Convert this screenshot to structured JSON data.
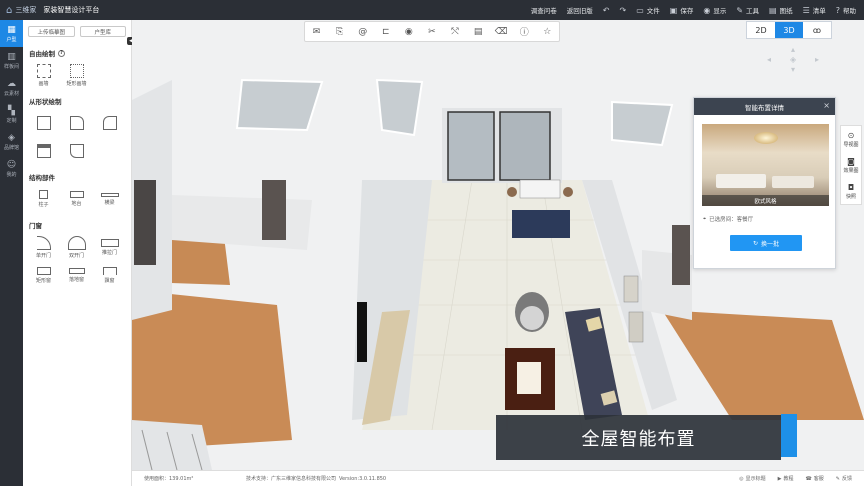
{
  "topbar": {
    "logo_text": "三维家",
    "app_title": "家装智慧设计平台",
    "menu": [
      {
        "label": "调查问卷",
        "icon": ""
      },
      {
        "label": "返回旧版",
        "icon": ""
      },
      {
        "label": "",
        "icon": "undo-icon"
      },
      {
        "label": "",
        "icon": "redo-icon"
      },
      {
        "label": "文件",
        "icon": "folder-icon"
      },
      {
        "label": "保存",
        "icon": "save-icon"
      },
      {
        "label": "显示",
        "icon": "eye-icon"
      },
      {
        "label": "工具",
        "icon": "wrench-icon"
      },
      {
        "label": "图纸",
        "icon": "drawing-icon"
      },
      {
        "label": "清单",
        "icon": "list-icon"
      },
      {
        "label": "帮助",
        "icon": "help-icon"
      }
    ]
  },
  "rail": [
    {
      "label": "户型",
      "icon": "floorplan-icon"
    },
    {
      "label": "样板间",
      "icon": "sample-room-icon"
    },
    {
      "label": "云素材",
      "icon": "cloud-icon"
    },
    {
      "label": "定制",
      "icon": "custom-icon"
    },
    {
      "label": "品牌馆",
      "icon": "tag-icon"
    },
    {
      "label": "我的",
      "icon": "user-icon"
    }
  ],
  "panel": {
    "tabs": [
      "上传临摹图",
      "户型库"
    ],
    "sections": [
      {
        "title": "自由绘制",
        "has_help": true,
        "items": [
          "画墙",
          "矩形画墙"
        ]
      },
      {
        "title": "从形状绘制",
        "has_help": false,
        "items": [
          "",
          "",
          "",
          "",
          ""
        ]
      },
      {
        "title": "结构部件",
        "has_help": false,
        "items": [
          "柱子",
          "地台",
          "横梁"
        ]
      },
      {
        "title": "门窗",
        "has_help": false,
        "items": [
          "单开门",
          "双开门",
          "推拉门",
          "矩形窗",
          "落地窗",
          "飘窗"
        ]
      }
    ]
  },
  "toolbar": {
    "icons": [
      "mail-icon",
      "copy-icon",
      "at-icon",
      "align-icon",
      "eye-icon",
      "scissors-icon",
      "split-icon",
      "layer-icon",
      "eraser-icon",
      "info-icon",
      "star-icon"
    ]
  },
  "view_switch": {
    "options": [
      "2D",
      "3D",
      "漫游"
    ],
    "active": "3D"
  },
  "right_tools": [
    "导视图",
    "效果图",
    "快照"
  ],
  "popup": {
    "title": "智能布置详情",
    "image_caption": "欧式风格",
    "room_text": "已选房间：客餐厅",
    "button_label": "换一批"
  },
  "banner": {
    "text": "全屋智能布置"
  },
  "status": {
    "area": "使用面积：139.01m²",
    "support": "技术支持：广东三维家信息科技有限公司",
    "version": "Version:3.0.11.850",
    "right": [
      "显示标题",
      "教程",
      "客服",
      "反馈"
    ]
  },
  "colors": {
    "accent": "#1e88e5",
    "dark": "#2b2f36"
  }
}
